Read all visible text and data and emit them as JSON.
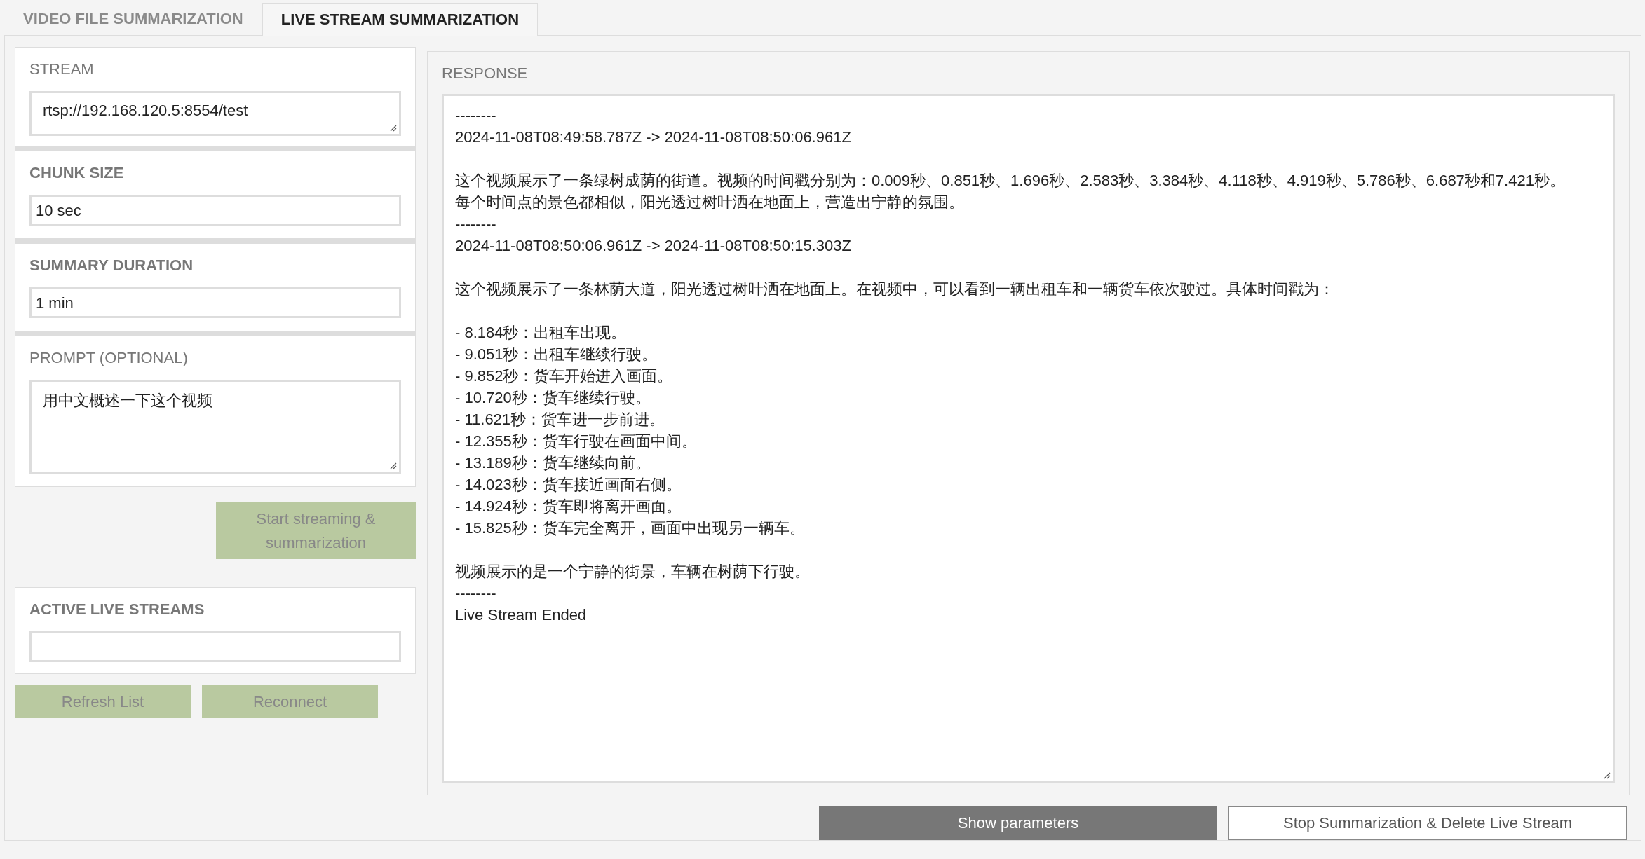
{
  "tabs": [
    {
      "label": "VIDEO FILE SUMMARIZATION",
      "selected": false
    },
    {
      "label": "LIVE STREAM SUMMARIZATION",
      "selected": true
    }
  ],
  "settings": [
    {
      "label": "STREAM",
      "kind": "textarea",
      "value": "rtsp://192.168.120.5:8554/test"
    },
    {
      "label": "CHUNK SIZE",
      "kind": "text",
      "value": "10 sec"
    },
    {
      "label": "SUMMARY DURATION",
      "kind": "text",
      "value": "1 min"
    },
    {
      "label": "PROMPT (OPTIONAL)",
      "kind": "textarea",
      "value": "用中文概述一下这个视频"
    }
  ],
  "start_button": {
    "label": "Start streaming & summarization",
    "disabled": true
  },
  "active_streams": {
    "label": "ACTIVE LIVE STREAMS"
  },
  "stream_buttons": [
    {
      "label": "Refresh List",
      "disabled": true
    },
    {
      "label": "Reconnect",
      "disabled": true
    }
  ],
  "response": {
    "label": "RESPONSE",
    "paragraphs": [
      [
        "--------",
        "2024-11-08T08:49:58.787Z -> 2024-11-08T08:50:06.961Z"
      ],
      [
        "这个视频展示了一条绿树成荫的街道。视频的时间戳分别为：0.009秒、0.851秒、1.696秒、2.583秒、3.384秒、4.118秒、4.919秒、5.786秒、6.687秒和7.421秒。",
        "每个时间点的景色都相似，阳光透过树叶洒在地面上，营造出宁静的氛围。",
        "--------",
        "2024-11-08T08:50:06.961Z -> 2024-11-08T08:50:15.303Z"
      ],
      [
        "这个视频展示了一条林荫大道，阳光透过树叶洒在地面上。在视频中，可以看到一辆出租车和一辆货车依次驶过。具体时间戳为："
      ],
      [
        "- 8.184秒：出租车出现。",
        "- 9.051秒：出租车继续行驶。",
        "- 9.852秒：货车开始进入画面。",
        "- 10.720秒：货车继续行驶。",
        "- 11.621秒：货车进一步前进。",
        "- 12.355秒：货车行驶在画面中间。",
        "- 13.189秒：货车继续向前。",
        "- 14.023秒：货车接近画面右侧。",
        "- 14.924秒：货车即将离开画面。",
        "- 15.825秒：货车完全离开，画面中出现另一辆车。"
      ],
      [
        "视频展示的是一个宁静的街景，车辆在树荫下行驶。",
        "--------",
        "Live Stream Ended"
      ]
    ]
  },
  "footer_buttons": [
    {
      "label": "Show parameters",
      "kind": "primary"
    },
    {
      "label": "Stop Summarization & Delete Live Stream",
      "kind": "secondary"
    }
  ]
}
